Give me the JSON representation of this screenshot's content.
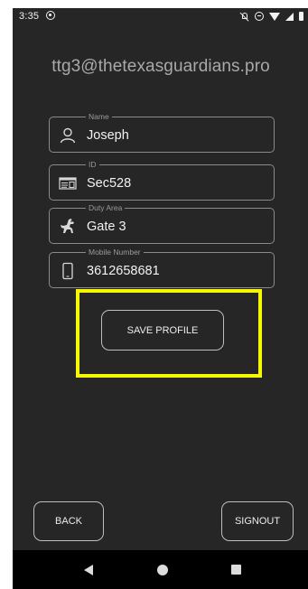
{
  "status_bar": {
    "time": "3:35",
    "icons": [
      "sync-icon",
      "mute-icon",
      "do-not-disturb-icon",
      "wifi-icon",
      "signal-icon",
      "battery-icon"
    ]
  },
  "header": {
    "email": "ttg3@thetexasguardians.pro"
  },
  "form": {
    "fields": [
      {
        "label": "Name",
        "value": "Joseph",
        "icon": "person-icon"
      },
      {
        "label": "ID",
        "value": "Sec528",
        "icon": "id-card-icon"
      },
      {
        "label": "Duty Area",
        "value": "Gate 3",
        "icon": "guard-dog-icon"
      },
      {
        "label": "Mobile Number",
        "value": "3612658681",
        "icon": "phone-icon"
      }
    ],
    "save_label": "SAVE PROFILE"
  },
  "footer": {
    "back_label": "BACK",
    "signout_label": "SIGNOUT"
  },
  "colors": {
    "background": "#262626",
    "highlight": "#f7f700",
    "text": "#f2f2f2",
    "muted_text": "#a9a9a9",
    "nav_bar": "#000000"
  }
}
